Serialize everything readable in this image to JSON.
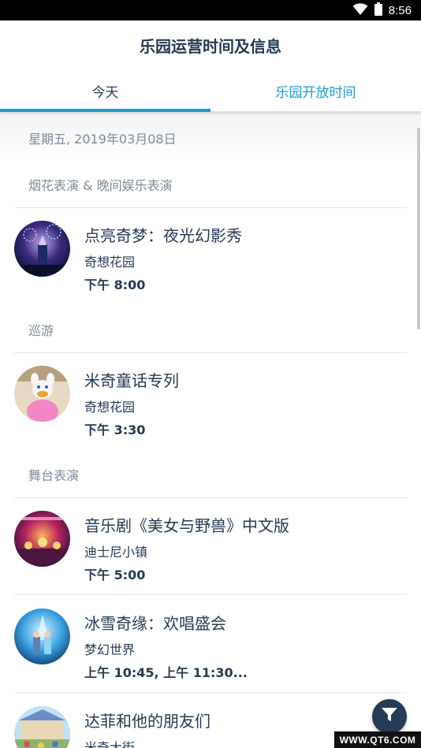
{
  "status_bar": {
    "time": "8:56"
  },
  "header": {
    "title": "乐园运营时间及信息"
  },
  "tabs": [
    {
      "label": "今天",
      "active": true
    },
    {
      "label": "乐园开放时间",
      "active": false
    }
  ],
  "date": "星期五, 2019年03月08日",
  "sections": [
    {
      "title": "烟花表演 & 晚间娱乐表演",
      "items": [
        {
          "name": "点亮奇梦：夜光幻影秀",
          "location": "奇想花园",
          "time": "下午 8:00"
        }
      ]
    },
    {
      "title": "巡游",
      "items": [
        {
          "name": "米奇童话专列",
          "location": "奇想花园",
          "time": "下午 3:30"
        }
      ]
    },
    {
      "title": "舞台表演",
      "items": [
        {
          "name": "音乐剧《美女与野兽》中文版",
          "location": "迪士尼小镇",
          "time": "下午 5:00"
        },
        {
          "name": "冰雪奇缘：欢唱盛会",
          "location": "梦幻世界",
          "time": "上午 10:45, 上午 11:30..."
        },
        {
          "name": "达菲和他的朋友们",
          "location": "米奇大街",
          "time": ""
        }
      ]
    }
  ],
  "filter_button": {
    "icon": "filter-icon"
  },
  "watermark": "WWW.QT6.COM",
  "colors": {
    "accent": "#1b9bc9",
    "text": "#253b56",
    "muted": "#7e8b9b",
    "fab": "#253b56"
  }
}
